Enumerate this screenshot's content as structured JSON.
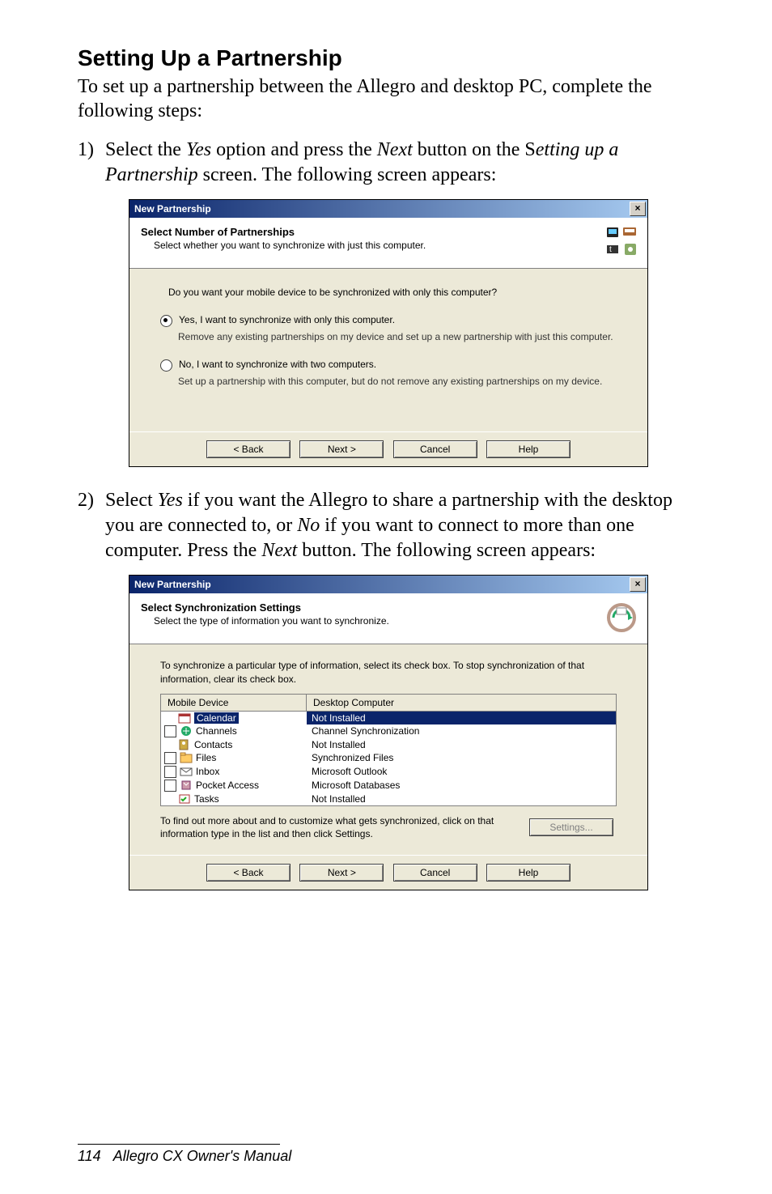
{
  "doc": {
    "heading": "Setting Up a Partnership",
    "intro": "To set up a partnership between the Allegro and desktop PC, complete the following steps:",
    "step1_num": "1)",
    "step1_a": "Select the ",
    "step1_b": "Yes",
    "step1_c": " option and press the ",
    "step1_d": "Next",
    "step1_e": " button on the S",
    "step1_f": "etting up a Partnership",
    "step1_g": " screen. The following screen appears:",
    "step2_num": "2)",
    "step2_a": "Select ",
    "step2_b": "Yes",
    "step2_c": " if you want the Allegro to share a partnership with the desktop you are connected to, or ",
    "step2_d": "No",
    "step2_e": " if you want to connect to more than one computer. Press the ",
    "step2_f": "Next",
    "step2_g": " button. The following screen appears:",
    "page_num": "114",
    "manual": "Allegro CX Owner's Manual"
  },
  "dlg1": {
    "title": "New Partnership",
    "head_title": "Select Number of Partnerships",
    "head_sub": "Select whether you want to synchronize with just this computer.",
    "question": "Do you want your mobile device to be synchronized with only this computer?",
    "opt_yes": "Yes, I want to synchronize with only this computer.",
    "opt_yes_desc": "Remove any existing partnerships on my device and set up a new partnership with just this computer.",
    "opt_no": "No, I want to synchronize with two computers.",
    "opt_no_desc": "Set up a partnership with this computer, but do not remove any existing partnerships on my device.",
    "back": "< Back",
    "next": "Next >",
    "cancel": "Cancel",
    "help": "Help"
  },
  "dlg2": {
    "title": "New Partnership",
    "head_title": "Select Synchronization Settings",
    "head_sub": "Select the type of information you want to synchronize.",
    "intro": "To synchronize a particular type of information, select its check box. To stop synchronization of that information, clear its check box.",
    "col_mobile": "Mobile Device",
    "col_desktop": "Desktop Computer",
    "rows": [
      {
        "name": "Calendar",
        "desktop": "Not Installed",
        "checked": false,
        "selected": true,
        "hasCheckbox": false
      },
      {
        "name": "Channels",
        "desktop": "Channel Synchronization",
        "checked": false,
        "selected": false,
        "hasCheckbox": true
      },
      {
        "name": "Contacts",
        "desktop": "Not Installed",
        "checked": false,
        "selected": false,
        "hasCheckbox": false
      },
      {
        "name": "Files",
        "desktop": "Synchronized Files",
        "checked": false,
        "selected": false,
        "hasCheckbox": true
      },
      {
        "name": "Inbox",
        "desktop": "Microsoft Outlook",
        "checked": false,
        "selected": false,
        "hasCheckbox": true
      },
      {
        "name": "Pocket Access",
        "desktop": "Microsoft Databases",
        "checked": false,
        "selected": false,
        "hasCheckbox": true
      },
      {
        "name": "Tasks",
        "desktop": "Not Installed",
        "checked": false,
        "selected": false,
        "hasCheckbox": false
      }
    ],
    "settings_hint": "To find out more about and to customize what gets synchronized, click on that information type in the list and then click Settings.",
    "settings_btn": "Settings...",
    "back": "< Back",
    "next": "Next >",
    "cancel": "Cancel",
    "help": "Help"
  }
}
